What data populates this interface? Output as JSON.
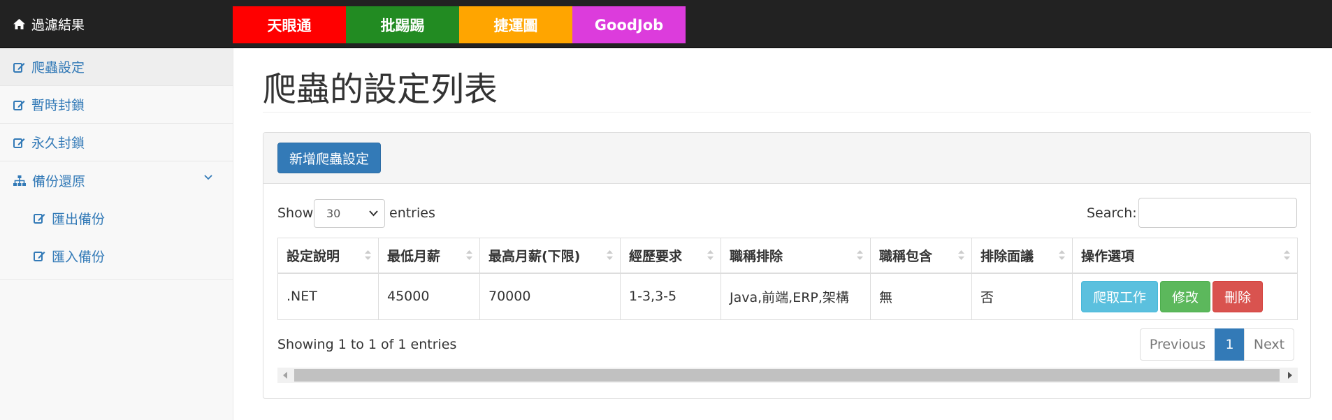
{
  "brand": {
    "label": "過濾結果",
    "icon": "home-icon"
  },
  "top_tabs": [
    {
      "label": "天眼通",
      "color": "#ff0000"
    },
    {
      "label": "批踢踢",
      "color": "#228b22"
    },
    {
      "label": "捷運圖",
      "color": "#ffa500"
    },
    {
      "label": "GoodJob",
      "color": "#dc3cdc"
    }
  ],
  "sidebar": {
    "items": [
      {
        "label": "爬蟲設定",
        "icon": "edit-icon"
      },
      {
        "label": "暫時封鎖",
        "icon": "edit-icon"
      },
      {
        "label": "永久封鎖",
        "icon": "edit-icon"
      }
    ],
    "group": {
      "label": "備份還原",
      "icon": "sitemap-icon",
      "children": [
        {
          "label": "匯出備份",
          "icon": "edit-icon"
        },
        {
          "label": "匯入備份",
          "icon": "edit-icon"
        }
      ]
    }
  },
  "page": {
    "title": "爬蟲的設定列表"
  },
  "panel": {
    "add_button": "新增爬蟲設定"
  },
  "table_controls": {
    "show_label": "Show",
    "length_value": "30",
    "entries_label": "entries",
    "search_label": "Search:",
    "search_value": ""
  },
  "table": {
    "columns": [
      "設定說明",
      "最低月薪",
      "最高月薪(下限)",
      "經歷要求",
      "職稱排除",
      "職稱包含",
      "排除面議",
      "操作選項"
    ],
    "rows": [
      {
        "cells": [
          ".NET",
          "45000",
          "70000",
          "1-3,3-5",
          "Java,前端,ERP,架構",
          "無",
          "否"
        ],
        "actions": [
          "爬取工作",
          "修改",
          "刪除"
        ]
      }
    ]
  },
  "info": "Showing 1 to 1 of 1 entries",
  "pagination": {
    "previous": "Previous",
    "current": "1",
    "next": "Next"
  },
  "colors": {
    "primary": "#337ab7",
    "info": "#5bc0de",
    "success": "#5cb85c",
    "danger": "#d9534f",
    "navbar": "#222222"
  }
}
